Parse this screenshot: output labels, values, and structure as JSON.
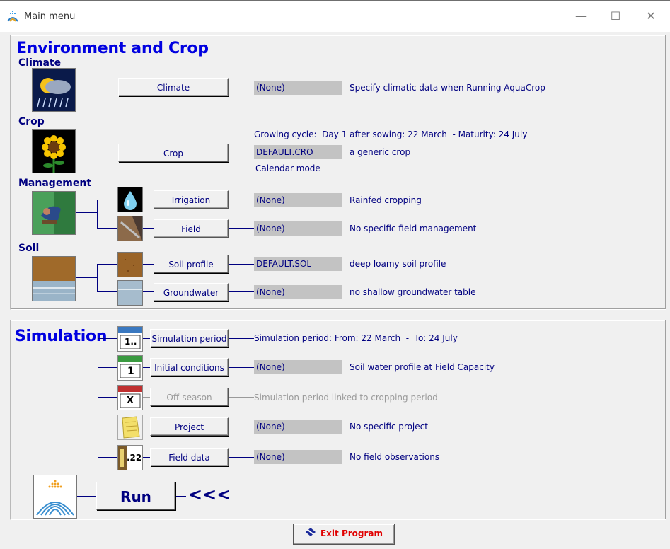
{
  "window": {
    "title": "Main menu",
    "minimize": "—",
    "maximize": "☐",
    "close": "✕"
  },
  "env": {
    "heading": "Environment and Crop",
    "climate": {
      "label": "Climate",
      "button": "Climate",
      "value": "(None)",
      "desc": "Specify climatic data when Running AquaCrop"
    },
    "crop": {
      "label": "Crop",
      "button": "Crop",
      "value": "DEFAULT.CRO",
      "desc": "a generic crop",
      "cycle": "Growing cycle:  Day 1 after sowing: 22 March  - Maturity: 24 July",
      "mode": "Calendar mode"
    },
    "management": {
      "label": "Management",
      "irrigation": {
        "button": "Irrigation",
        "value": "(None)",
        "desc": "Rainfed cropping"
      },
      "field": {
        "button": "Field",
        "value": "(None)",
        "desc": "No specific field management"
      }
    },
    "soil": {
      "label": "Soil",
      "profile": {
        "button": "Soil profile",
        "value": "DEFAULT.SOL",
        "desc": "deep loamy soil profile"
      },
      "groundwater": {
        "button": "Groundwater",
        "value": "(None)",
        "desc": "no shallow groundwater table"
      }
    }
  },
  "sim": {
    "heading": "Simulation",
    "period": {
      "button": "Simulation period",
      "desc": "Simulation period: From: 22 March  -  To: 24 July",
      "icon_text": "1.."
    },
    "initial": {
      "button": "Initial conditions",
      "value": "(None)",
      "desc": "Soil water profile at Field Capacity",
      "icon_text": "1"
    },
    "offseason": {
      "button": "Off-season",
      "desc": "Simulation period linked to cropping period",
      "icon_text": "X"
    },
    "project": {
      "button": "Project",
      "value": "(None)",
      "desc": "No specific project"
    },
    "fielddata": {
      "button": "Field data",
      "value": "(None)",
      "desc": "No field observations",
      "icon_text": ".22"
    }
  },
  "run": {
    "button": "Run",
    "arrows": "<<<"
  },
  "exit": {
    "button": "Exit Program"
  }
}
